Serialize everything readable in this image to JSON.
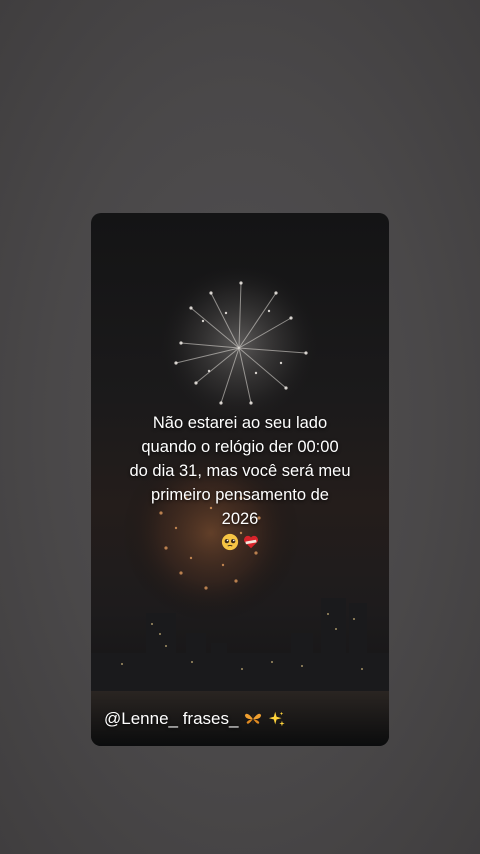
{
  "story": {
    "caption_lines": [
      "Não estarei ao seu lado",
      "quando o relógio der 00:00",
      "do dia 31, mas você será meu",
      "primeiro pensamento de",
      "2026"
    ],
    "caption_emojis": [
      "pleading-face-icon",
      "mending-heart-icon"
    ],
    "watermark_handle": "@Lenne_ frases_",
    "watermark_emojis": [
      "butterfly-icon",
      "sparkles-icon"
    ]
  },
  "colors": {
    "page_background": "#4a4849",
    "card_background": "#1a191a",
    "caption_text": "#ffffff"
  }
}
